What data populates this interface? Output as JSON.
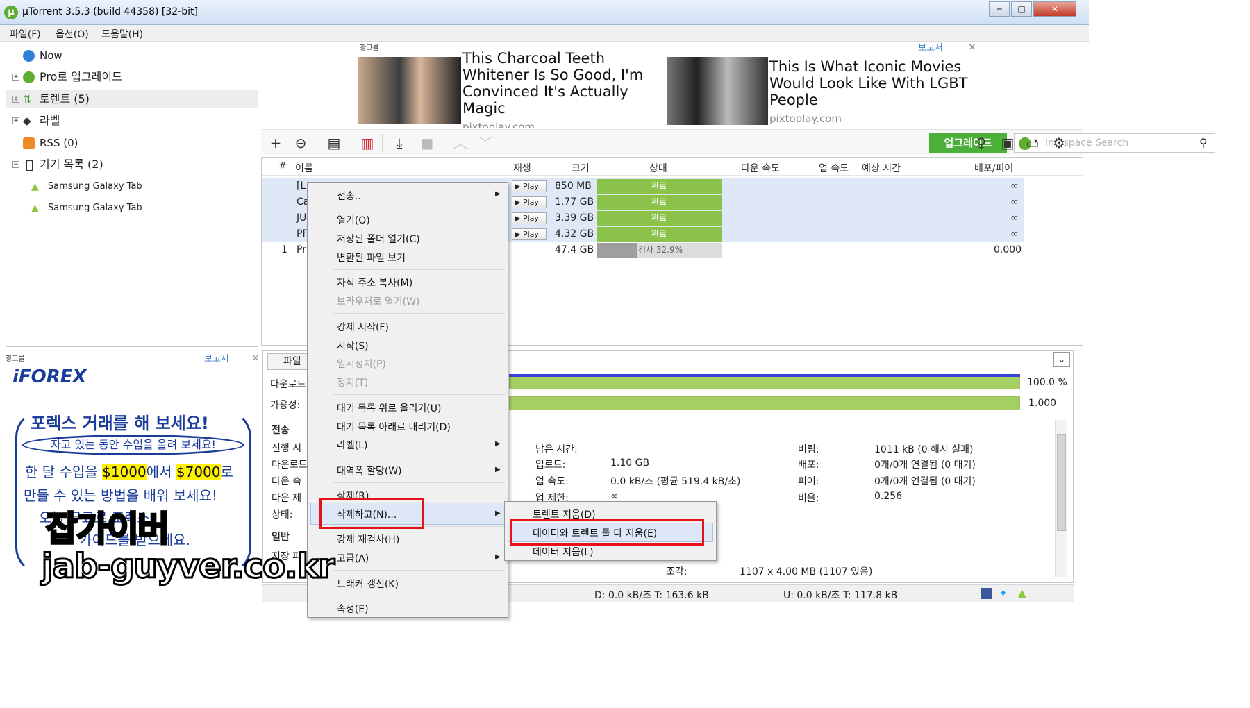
{
  "window": {
    "title": "µTorrent 3.5.3  (build 44358) [32-bit]"
  },
  "menu": [
    "파일(F)",
    "옵션(O)",
    "도움말(H)"
  ],
  "sidebar": [
    {
      "label": "Now",
      "expander": false
    },
    {
      "label": "Pro로 업그레이드",
      "expander": true
    },
    {
      "label": "토렌트 (5)",
      "expander": true
    },
    {
      "label": "라벨",
      "expander": true
    },
    {
      "label": "RSS (0)",
      "expander": false
    },
    {
      "label": "기기 목록 (2)",
      "expander": true
    },
    {
      "label": "Samsung Galaxy Tab",
      "expander": false
    },
    {
      "label": "Samsung Galaxy Tab",
      "expander": false
    }
  ],
  "top_ad": {
    "tag": "광고를",
    "report": "보고서",
    "close": "×",
    "ad1_lines": [
      "This Charcoal Teeth",
      "Whitener Is So Good, I'm",
      "Convinced It's Actually",
      "Magic"
    ],
    "ad1_source": "pixtoplay.com",
    "ad2_lines": [
      "This Is What Iconic Movies",
      "Would Look Like With LGBT",
      "People"
    ],
    "ad2_source": "pixtoplay.com"
  },
  "toolbar": {
    "upgrade": "업그레이드",
    "search_placeholder": "Infospace Search"
  },
  "columns": [
    "#",
    "이름",
    "재생",
    "크기",
    "상태",
    "다운 속도",
    "업 속도",
    "예상 시간",
    "배포/피어"
  ],
  "torrents": [
    {
      "num": "",
      "name": "[L",
      "play": "▶ Play N",
      "size": "850 MB",
      "status": "완료",
      "ratio": "∞"
    },
    {
      "num": "",
      "name": "Ca",
      "play": "▶ Play N",
      "size": "1.77 GB",
      "status": "완료",
      "ratio": "∞"
    },
    {
      "num": "",
      "name": "JU",
      "play": "▶ Play N",
      "size": "3.39 GB",
      "status": "완료",
      "ratio": "∞"
    },
    {
      "num": "",
      "name": "PF",
      "play": "▶ Play N",
      "size": "4.32 GB",
      "status": "완료",
      "ratio": "∞"
    },
    {
      "num": "1",
      "name": "Pr",
      "play": "",
      "size": "47.4 GB",
      "status": "검사 32.9%",
      "progress": 0.329,
      "ratio": "0.000"
    }
  ],
  "left_ad": {
    "tag": "광고를",
    "report": "보고서",
    "close": "×",
    "brand": "iFOREX",
    "line1": "포렉스 거래를 해 보세요!",
    "line2": "자고 있는 동안 수입을 올려 보세요!",
    "line3a": "한 달 수입을 ",
    "amount1": "$1000",
    "line3b": "에서 ",
    "amount2": "$7000",
    "line3c": "로",
    "line4": "만들 수 있는 방법을 배워 보세요!",
    "line5": "오늘 무료로 포렉스",
    "line6": "가이드를 받으세요."
  },
  "bottom": {
    "tab": "파일",
    "downloaded_label": "다운로드",
    "downloaded_pct": "100.0 %",
    "availability_label": "가용성:",
    "availability": "1.000",
    "section_transfer": "전송",
    "left_labels": [
      "진행 시",
      "다운로드",
      "다운 속",
      "다운 제",
      "상태:"
    ],
    "section_general": "일반",
    "save_label": "저장 파",
    "mid": [
      {
        "label": "남은 시간:",
        "value": ""
      },
      {
        "label": "업로드:",
        "value": "1.10 GB"
      },
      {
        "label": "업 속도:",
        "value": "0.0 kB/초 (평균 519.4 kB/초)"
      },
      {
        "label": "업 제한:",
        "value": "∞"
      }
    ],
    "right": [
      {
        "label": "버림:",
        "value": "1011 kB (0 해시 실패)"
      },
      {
        "label": "배포:",
        "value": "0개/0개 연결됨 (0 대기)"
      },
      {
        "label": "피어:",
        "value": "0개/0개 연결됨 (0 대기)"
      },
      {
        "label": "비율:",
        "value": "0.256"
      }
    ],
    "pieces_label": "조각:",
    "pieces_value": "1107 x 4.00 MB (1107 있음)"
  },
  "statusbar": {
    "download": "D: 0.0 kB/초 T: 163.6 kB",
    "upload": "U: 0.0 kB/초 T: 117.8 kB"
  },
  "context_menu": {
    "items": [
      {
        "label": "전송..",
        "disabled": false,
        "submenu": true
      },
      {
        "label": "열기(O)",
        "disabled": false,
        "submenu": false
      },
      {
        "label": "저장된 폴더 열기(C)",
        "disabled": false,
        "submenu": false
      },
      {
        "label": "변환된 파일 보기",
        "disabled": false,
        "submenu": false
      },
      {
        "label": "자석 주소 복사(M)",
        "disabled": false,
        "submenu": false
      },
      {
        "label": "브라우저로 열기(W)",
        "disabled": true,
        "submenu": false
      },
      {
        "label": "강제 시작(F)",
        "disabled": false,
        "submenu": false
      },
      {
        "label": "시작(S)",
        "disabled": false,
        "submenu": false
      },
      {
        "label": "일시정지(P)",
        "disabled": true,
        "submenu": false
      },
      {
        "label": "정지(T)",
        "disabled": true,
        "submenu": false
      },
      {
        "label": "대기 목록 위로 올리기(U)",
        "disabled": false,
        "submenu": false
      },
      {
        "label": "대기 목록 아래로 내리기(D)",
        "disabled": false,
        "submenu": false
      },
      {
        "label": "라벨(L)",
        "disabled": false,
        "submenu": true
      },
      {
        "label": "대역폭 할당(W)",
        "disabled": false,
        "submenu": true
      },
      {
        "label": "삭제(R)",
        "disabled": false,
        "submenu": false
      },
      {
        "label": "삭제하고(N)...",
        "disabled": false,
        "submenu": true
      },
      {
        "label": "강제 재검사(H)",
        "disabled": false,
        "submenu": false
      },
      {
        "label": "고급(A)",
        "disabled": false,
        "submenu": true
      },
      {
        "label": "트래커 갱신(K)",
        "disabled": false,
        "submenu": false
      },
      {
        "label": "속성(E)",
        "disabled": false,
        "submenu": false
      }
    ]
  },
  "submenu": [
    "토렌트 지움(D)",
    "데이터와 토렌트 둘 다 지움(E)",
    "데이터 지움(L)"
  ],
  "watermark": {
    "line1": "잡가이버",
    "line2": "jab-guyver.co.kr"
  },
  "colors": {
    "accent_green": "#4caf3a",
    "status_done": "#8bc34a",
    "highlight_red": "#e8111a",
    "selection": "#dfe8f6"
  }
}
